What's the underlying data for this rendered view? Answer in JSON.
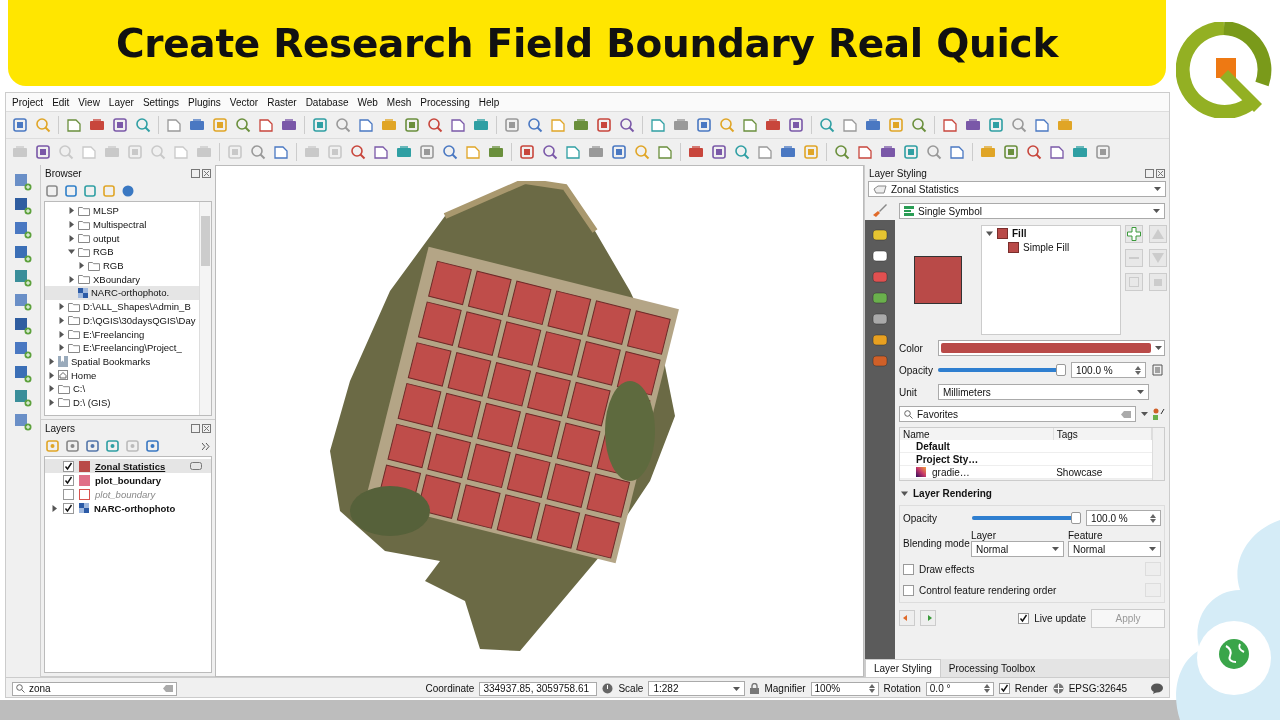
{
  "banner": {
    "title": "Create Research Field Boundary Real Quick"
  },
  "menu": [
    "Project",
    "Edit",
    "View",
    "Layer",
    "Settings",
    "Plugins",
    "Vector",
    "Raster",
    "Database",
    "Web",
    "Mesh",
    "Processing",
    "Help"
  ],
  "browser": {
    "title": "Browser",
    "items": [
      {
        "children": [
          {
            "children": [
              {
                "label": "MLSP",
                "kind": "folder",
                "expanded": false
              },
              {
                "label": "Multispectral",
                "kind": "folder",
                "expanded": false
              },
              {
                "label": "output",
                "kind": "folder",
                "expanded": false
              },
              {
                "label": "RGB",
                "kind": "folder",
                "expanded": true,
                "children": [
                  {
                    "label": "RGB",
                    "kind": "folder",
                    "expanded": false
                  }
                ]
              },
              {
                "label": "XBoundary",
                "kind": "folder",
                "expanded": false
              },
              {
                "label": "NARC-orthophoto.",
                "kind": "raster",
                "selected": true
              }
            ]
          },
          {
            "label": "D:\\ALL_Shapes\\Admin_B",
            "kind": "folder",
            "expanded": false
          },
          {
            "label": "D:\\QGIS\\30daysQGIS\\Day",
            "kind": "folder",
            "expanded": false
          },
          {
            "label": "E:\\Freelancing",
            "kind": "folder",
            "expanded": false
          },
          {
            "label": "E:\\Freelancing\\Project_",
            "kind": "folder",
            "expanded": false
          }
        ]
      },
      {
        "label": "Spatial Bookmarks",
        "kind": "bookmarks",
        "expanded": false
      },
      {
        "label": "Home",
        "kind": "home",
        "expanded": false
      },
      {
        "label": "C:\\",
        "kind": "folder",
        "expanded": false
      },
      {
        "label": "D:\\ (GIS)",
        "kind": "folder",
        "expanded": false
      }
    ]
  },
  "layers": {
    "title": "Layers",
    "items": [
      {
        "name": "Zonal Statistics",
        "kind": "fill",
        "color": "#b94a48",
        "checked": true,
        "selected": true
      },
      {
        "name": "plot_boundary",
        "kind": "fill",
        "color": "#e07088",
        "checked": true,
        "selected": false
      },
      {
        "name": "plot_boundary",
        "kind": "outline",
        "color": "#d9534f",
        "checked": false,
        "selected": false
      },
      {
        "name": "NARC-orthophoto",
        "kind": "raster",
        "checked": true,
        "selected": false,
        "expanded": false
      }
    ]
  },
  "layer_styling": {
    "title": "Layer Styling",
    "layer": "Zonal Statistics",
    "renderer": "Single Symbol",
    "symbol": {
      "color": "#b94a48",
      "tree": [
        {
          "label": "Fill",
          "expanded": true,
          "children": [
            {
              "label": "Simple Fill"
            }
          ]
        }
      ]
    },
    "color_label": "Color",
    "opacity": {
      "label": "Opacity",
      "level": 1,
      "reading": "100.0 %"
    },
    "unit": {
      "label": "Unit",
      "value": "Millimeters"
    },
    "style_search": {
      "value": "Favorites"
    },
    "style_table": {
      "columns": [
        "Name",
        "Tags"
      ],
      "rows": [
        {
          "kind": "group",
          "cells": [
            "Default"
          ]
        },
        {
          "kind": "group",
          "cells": [
            "Project Sty…"
          ]
        },
        {
          "kind": "gradient",
          "cells": [
            "gradie…",
            "Showcase"
          ]
        }
      ]
    },
    "rendering": {
      "title": "Layer Rendering",
      "expanded": true,
      "opacity": {
        "label": "Opacity",
        "level": 1,
        "reading": "100.0 %"
      },
      "blending": {
        "label": "Blending mode",
        "layer": {
          "label": "Layer",
          "value": "Normal"
        },
        "feature": {
          "label": "Feature",
          "value": "Normal"
        }
      },
      "options": [
        {
          "label": "Draw effects",
          "checked": false
        },
        {
          "label": "Control feature rendering order",
          "checked": false
        }
      ]
    },
    "live_update": {
      "label": "Live update",
      "checked": true
    },
    "apply": {
      "label": "Apply",
      "disabled": true
    },
    "tabs": [
      {
        "label": "Layer Styling",
        "selected": true
      },
      {
        "label": "Processing Toolbox",
        "selected": false
      }
    ]
  },
  "status_bar": {
    "locator": {
      "value": "zona"
    },
    "coordinate": {
      "label": "Coordinate",
      "value": "334937.85, 3059758.61"
    },
    "scale": {
      "label": "Scale",
      "value": "1:282"
    },
    "magnifier": {
      "label": "Magnifier",
      "value": "100%"
    },
    "rotation": {
      "label": "Rotation",
      "value": "0.0 °"
    },
    "render": {
      "label": "Render",
      "checked": true
    },
    "crs": "EPSG:32645"
  }
}
